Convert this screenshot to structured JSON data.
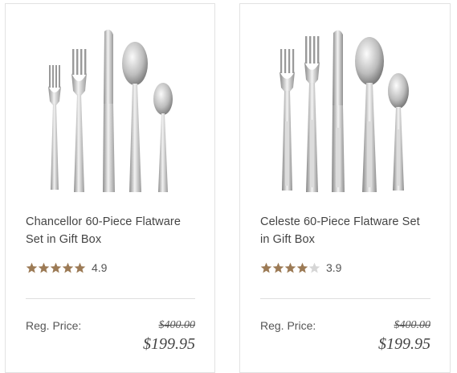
{
  "products": [
    {
      "title": "Chancellor 60-Piece Flatware Set in Gift Box",
      "rating": 4.9,
      "rating_label": "4.9",
      "stars_filled": 5,
      "reg_label": "Reg. Price:",
      "original_price": "$400.00",
      "sale_price": "$199.95",
      "image_icon": "flatware-set-image"
    },
    {
      "title": "Celeste 60-Piece Flatware Set in Gift Box",
      "rating": 3.9,
      "rating_label": "3.9",
      "stars_filled": 4,
      "reg_label": "Reg. Price:",
      "original_price": "$400.00",
      "sale_price": "$199.95",
      "image_icon": "flatware-set-image"
    }
  ],
  "colors": {
    "star_filled": "#9c7a55",
    "star_empty": "#d6d6d6",
    "text": "#444444",
    "border": "#e2e2e2"
  }
}
